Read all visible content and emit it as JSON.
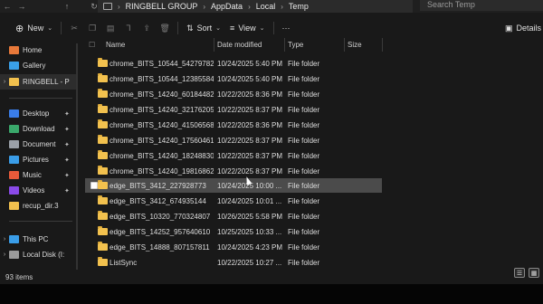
{
  "addressbar": {
    "crumbs": [
      "RINGBELL GROUP",
      "AppData",
      "Local",
      "Temp"
    ],
    "search_placeholder": "Search Temp"
  },
  "toolbar": {
    "new_label": "New",
    "sort_label": "Sort",
    "view_label": "View",
    "more_label": "···",
    "details_label": "Details"
  },
  "nav": {
    "items": [
      {
        "label": "Home",
        "icon": "home-icon",
        "color": "#e8793a"
      },
      {
        "label": "Gallery",
        "icon": "gallery-icon",
        "color": "#3aa0e8"
      },
      {
        "label": "RINGBELL - P",
        "icon": "folder-icon",
        "color": "#f2c14e"
      },
      {
        "label": "Desktop",
        "icon": "desktop-icon",
        "color": "#3a7de8"
      },
      {
        "label": "Download",
        "icon": "download-icon",
        "color": "#3aa86b"
      },
      {
        "label": "Document",
        "icon": "document-icon",
        "color": "#9aa0a8"
      },
      {
        "label": "Pictures",
        "icon": "pictures-icon",
        "color": "#3a9de8"
      },
      {
        "label": "Music",
        "icon": "music-icon",
        "color": "#e85a3a"
      },
      {
        "label": "Videos",
        "icon": "videos-icon",
        "color": "#8a4ae8"
      },
      {
        "label": "recup_dir.3",
        "icon": "folder-icon",
        "color": "#f2c14e"
      },
      {
        "label": "This PC",
        "icon": "this-pc-icon",
        "color": "#3a9de8"
      },
      {
        "label": "Local Disk (I:",
        "icon": "disk-icon",
        "color": "#9a9a9a"
      }
    ]
  },
  "columns": {
    "name": "Name",
    "date": "Date modified",
    "type": "Type",
    "size": "Size"
  },
  "files": [
    {
      "name": "chrome_BITS_10544_54279782",
      "date": "10/24/2025 5:40 PM",
      "type": "File folder"
    },
    {
      "name": "chrome_BITS_10544_12385584...",
      "date": "10/24/2025 5:40 PM",
      "type": "File folder"
    },
    {
      "name": "chrome_BITS_14240_60184482",
      "date": "10/22/2025 8:36 PM",
      "type": "File folder"
    },
    {
      "name": "chrome_BITS_14240_321762056",
      "date": "10/22/2025 8:37 PM",
      "type": "File folder"
    },
    {
      "name": "chrome_BITS_14240_415065686",
      "date": "10/22/2025 8:36 PM",
      "type": "File folder"
    },
    {
      "name": "chrome_BITS_14240_17560461...",
      "date": "10/22/2025 8:37 PM",
      "type": "File folder"
    },
    {
      "name": "chrome_BITS_14240_18248830...",
      "date": "10/22/2025 8:37 PM",
      "type": "File folder"
    },
    {
      "name": "chrome_BITS_14240_19816862...",
      "date": "10/22/2025 8:37 PM",
      "type": "File folder"
    },
    {
      "name": "edge_BITS_3412_227928773",
      "date": "10/24/2025 10:00 ...",
      "type": "File folder"
    },
    {
      "name": "edge_BITS_3412_674935144",
      "date": "10/24/2025 10:01 ...",
      "type": "File folder"
    },
    {
      "name": "edge_BITS_10320_770324807",
      "date": "10/26/2025 5:58 PM",
      "type": "File folder"
    },
    {
      "name": "edge_BITS_14252_957640610",
      "date": "10/25/2025 10:33 ...",
      "type": "File folder"
    },
    {
      "name": "edge_BITS_14888_807157811",
      "date": "10/24/2025 4:23 PM",
      "type": "File folder"
    },
    {
      "name": "ListSync",
      "date": "10/22/2025 10:27 ...",
      "type": "File folder"
    }
  ],
  "status": {
    "item_count": "93 items"
  }
}
